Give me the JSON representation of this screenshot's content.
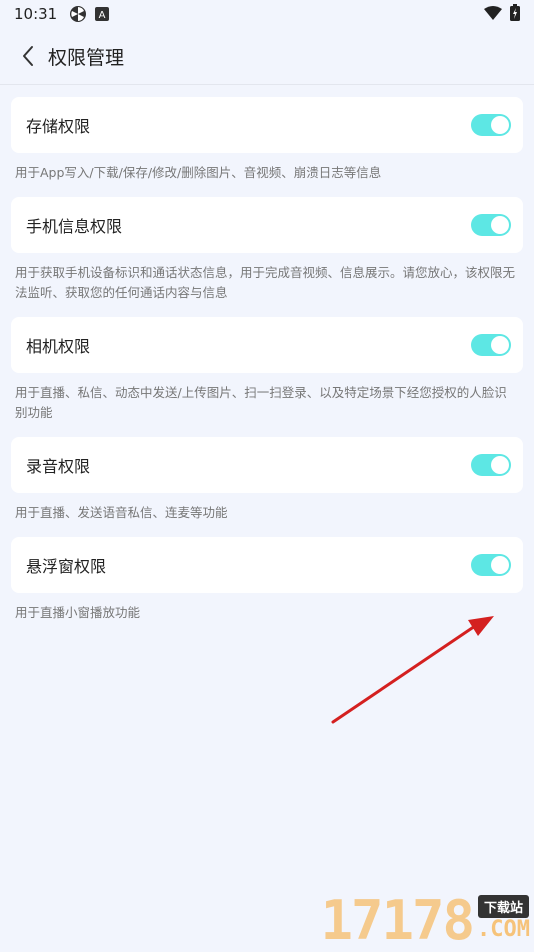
{
  "status_bar": {
    "time": "10:31",
    "app_icon_letter": "A"
  },
  "header": {
    "title": "权限管理"
  },
  "permissions": [
    {
      "label": "存储权限",
      "description": "用于App写入/下载/保存/修改/删除图片、音视频、崩溃日志等信息",
      "enabled": true
    },
    {
      "label": "手机信息权限",
      "description": "用于获取手机设备标识和通话状态信息，用于完成音视频、信息展示。请您放心，该权限无法监听、获取您的任何通话内容与信息",
      "enabled": true
    },
    {
      "label": "相机权限",
      "description": "用于直播、私信、动态中发送/上传图片、扫一扫登录、以及特定场景下经您授权的人脸识别功能",
      "enabled": true
    },
    {
      "label": "录音权限",
      "description": "用于直播、发送语音私信、连麦等功能",
      "enabled": true
    },
    {
      "label": "悬浮窗权限",
      "description": "用于直播小窗播放功能",
      "enabled": true
    }
  ],
  "watermark": {
    "number": "17178",
    "badge": "下载站",
    "domain": ".COM"
  },
  "colors": {
    "toggle_on": "#5de7e4",
    "background": "#f2f5fd",
    "annotation_arrow": "#d42020"
  }
}
